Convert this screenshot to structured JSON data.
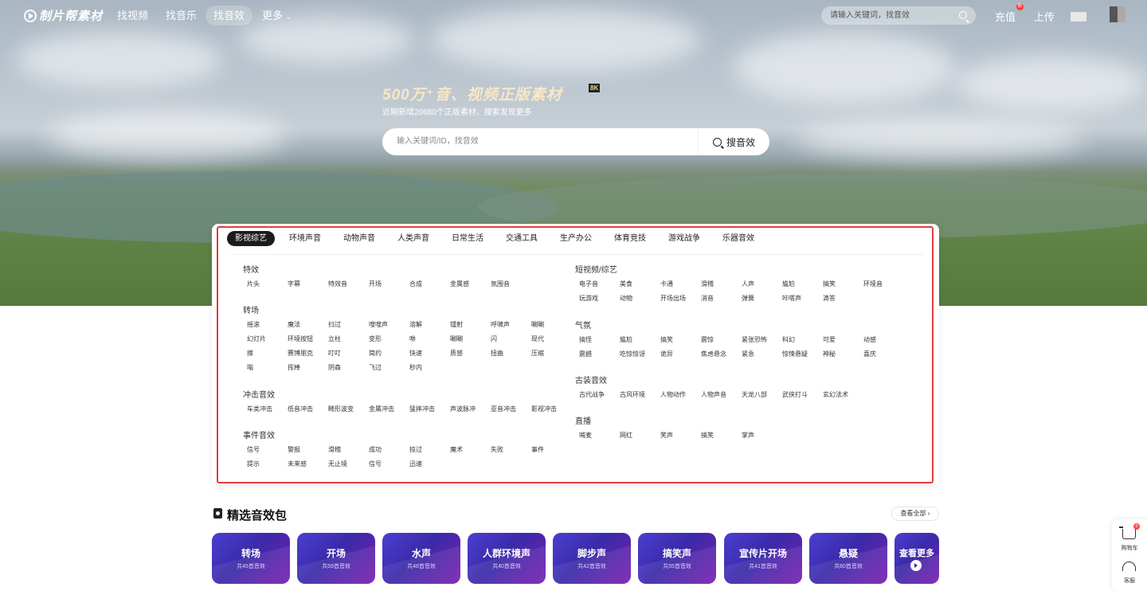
{
  "nav": {
    "logo": "制片帮素材",
    "items": [
      "找视频",
      "找音乐",
      "找音效",
      "更多"
    ],
    "more_chevron": "⌄",
    "search_placeholder": "请输入关键词，找音效",
    "recharge": "充值",
    "new_badge": "新",
    "upload": "上传"
  },
  "hero": {
    "title": "500万⁺音、视频正版素材",
    "badge": "8K",
    "subtitle": "近期新增20680个正版素材，搜索发现更多",
    "search_placeholder": "输入关键词/ID，找音效",
    "search_button": "搜音效"
  },
  "category_tabs": [
    "影视综艺",
    "环境声音",
    "动物声音",
    "人类声音",
    "日常生活",
    "交通工具",
    "生产办公",
    "体育竞技",
    "游戏战争",
    "乐器音效"
  ],
  "left_groups": [
    {
      "title": "特效",
      "rows": [
        [
          "片头",
          "字幕",
          "特效音",
          "开场",
          "合成",
          "金属感",
          "氛围音"
        ]
      ]
    },
    {
      "title": "转场",
      "rows": [
        [
          "摇滚",
          "魔法",
          "扫过",
          "嗖嗖声",
          "溶解",
          "镭射",
          "呼啸声",
          "唰唰"
        ],
        [
          "幻灯片",
          "环境按钮",
          "立柱",
          "变形",
          "咻",
          "唰唰",
          "闪",
          "现代"
        ],
        [
          "擦",
          "赛博朋克",
          "叮叮",
          "简约",
          "快速",
          "质感",
          "扭曲",
          "压缩"
        ],
        [
          "嗡",
          "挥棒",
          "阴森",
          "飞过",
          "秒内"
        ]
      ]
    },
    {
      "title": "冲击音效",
      "rows": [
        [
          "车类冲击",
          "低音冲击",
          "畸形波变",
          "金属冲击",
          "猛摔冲击",
          "声波脉冲",
          "亚音冲击",
          "影视冲击"
        ]
      ]
    },
    {
      "title": "事件音效",
      "rows": [
        [
          "信号",
          "警报",
          "滑稽",
          "成功",
          "掠过",
          "魔术",
          "失败",
          "事件"
        ],
        [
          "提示",
          "未来感",
          "无止境",
          "信号",
          "迅速"
        ]
      ]
    }
  ],
  "right_groups": [
    {
      "title": "短视频/综艺",
      "rows": [
        [
          "电子音",
          "美食",
          "卡通",
          "滑稽",
          "人声",
          "尴尬",
          "搞笑",
          "环境音"
        ],
        [
          "玩游戏",
          "动物",
          "开场出场",
          "消音",
          "弹簧",
          "咔嗒声",
          "滴答"
        ]
      ]
    },
    {
      "title": "气氛",
      "rows": [
        [
          "搞怪",
          "尴尬",
          "搞笑",
          "震惊",
          "紧张恐怖",
          "科幻",
          "可爱",
          "动感"
        ],
        [
          "震撼",
          "吃惊惊讶",
          "诡异",
          "焦虑悬念",
          "紧急",
          "惊悚悬疑",
          "神秘",
          "喜庆"
        ]
      ]
    },
    {
      "title": "古装音效",
      "rows": [
        [
          "古代战争",
          "古风环境",
          "人物动作",
          "人物声音",
          "天龙八部",
          "武侠打斗",
          "玄幻法术"
        ]
      ]
    },
    {
      "title": "直播",
      "rows": [
        [
          "喊麦",
          "网红",
          "笑声",
          "搞笑",
          "掌声"
        ]
      ]
    }
  ],
  "featured": {
    "title": "精选音效包",
    "view_all": "查看全部 ›",
    "packs": [
      {
        "name": "转场",
        "count": "共45首音效"
      },
      {
        "name": "开场",
        "count": "共59首音效"
      },
      {
        "name": "水声",
        "count": "共48首音效"
      },
      {
        "name": "人群环境声",
        "count": "共40首音效"
      },
      {
        "name": "脚步声",
        "count": "共42首音效"
      },
      {
        "name": "搞笑声",
        "count": "共55首音效"
      },
      {
        "name": "宣传片开场",
        "count": "共41首音效"
      },
      {
        "name": "悬疑",
        "count": "共60首音效"
      }
    ],
    "more": "查看更多"
  },
  "float": {
    "cart": "购物车",
    "cart_badge": "0",
    "service": "客服"
  },
  "colors": {
    "accent_outline": "#e43b3b",
    "pack_gradient_start": "#4b3fd1",
    "pack_gradient_end": "#7a1fb0",
    "active_tab": "#1c1c1c"
  }
}
